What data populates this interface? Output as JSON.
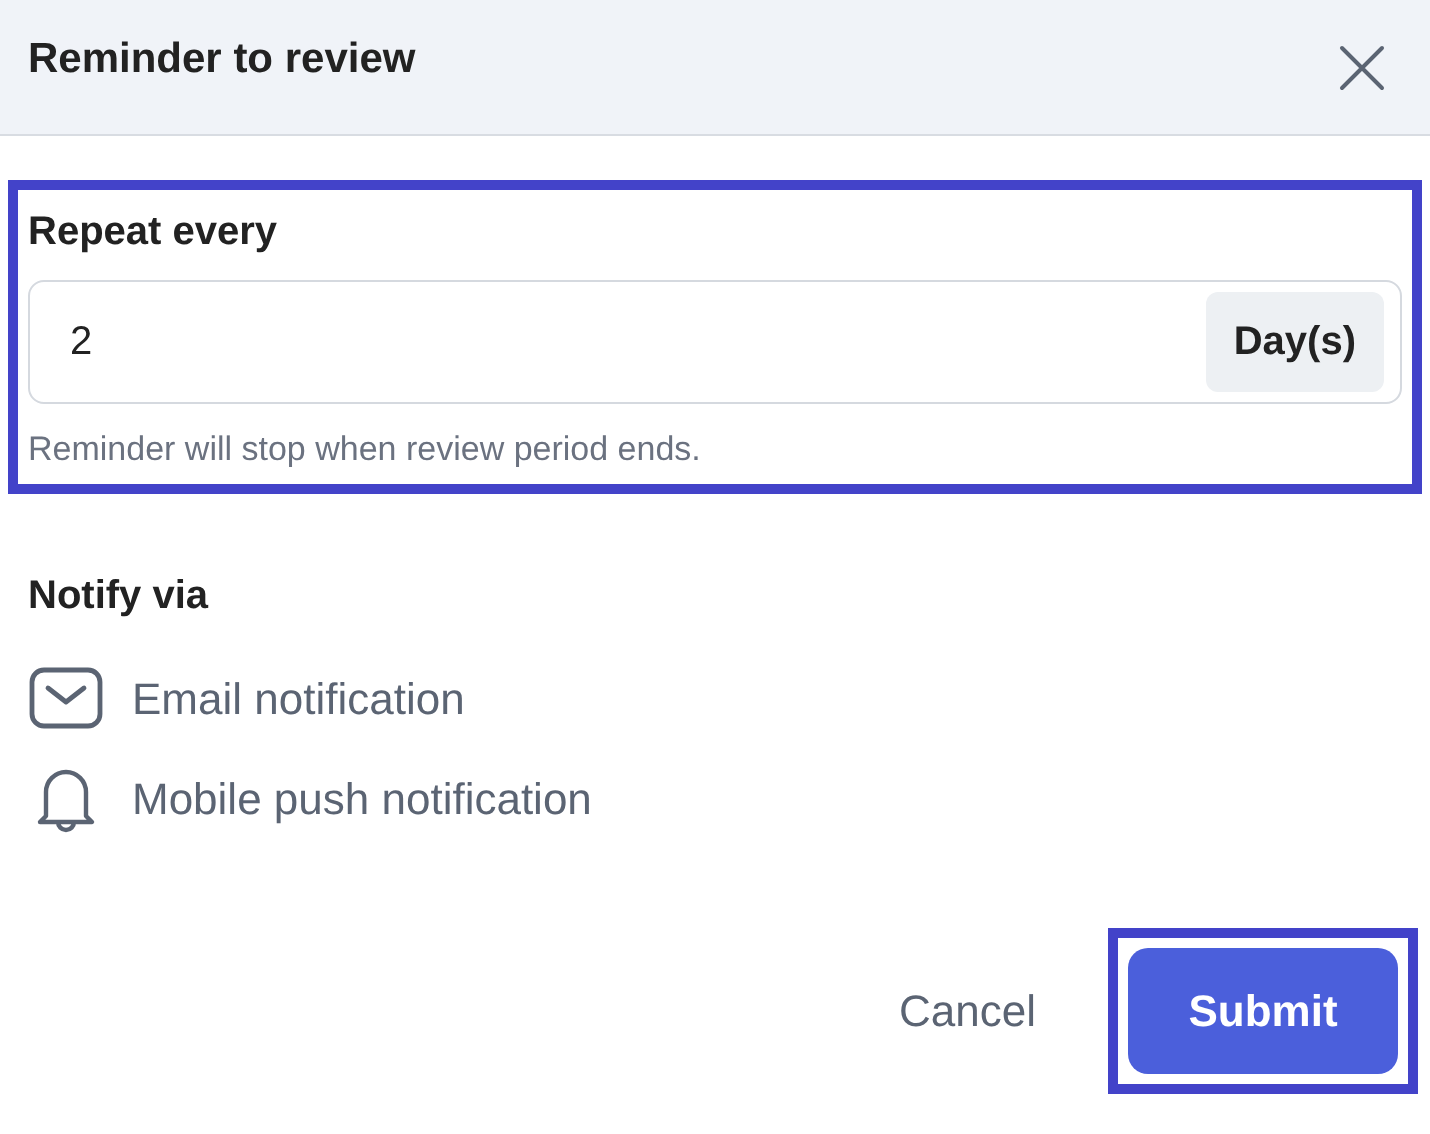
{
  "dialog": {
    "title": "Reminder to review"
  },
  "repeat": {
    "label": "Repeat every",
    "value": "2",
    "unit": "Day(s)",
    "hint": "Reminder will stop when review period ends.",
    "highlighted": true
  },
  "notify": {
    "label": "Notify via",
    "items": [
      {
        "kind": "email",
        "label": "Email notification"
      },
      {
        "kind": "push",
        "label": "Mobile push notification"
      }
    ]
  },
  "buttons": {
    "cancel": "Cancel",
    "submit": "Submit",
    "submit_highlighted": true
  }
}
